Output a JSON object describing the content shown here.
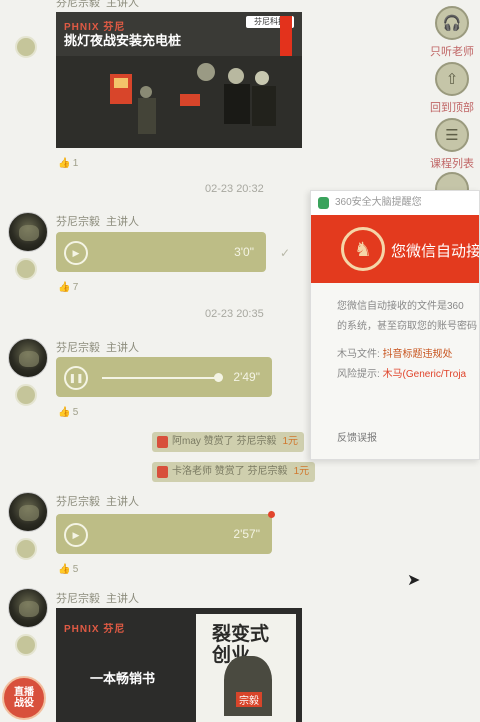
{
  "chat": {
    "sender_name": "芬尼宗毅",
    "sender_role": "主讲人",
    "messages": [
      {
        "type": "image",
        "brand": "PHNIX 芬尼",
        "headline": "挑灯夜战安装充电桩",
        "logo": "芬尼科技",
        "likes": "1"
      },
      {
        "timestamp": "02-23 20:32"
      },
      {
        "type": "audio",
        "duration": "3'0\"",
        "likes": "7",
        "read": true
      },
      {
        "timestamp": "02-23 20:35"
      },
      {
        "type": "audio",
        "duration": "2'49\"",
        "likes": "5",
        "playing": true,
        "progress_fraction": 0.97
      },
      {
        "type": "audio",
        "duration": "2'57\"",
        "likes": "5",
        "unread": true
      },
      {
        "type": "image",
        "brand": "PHNIX 芬尼",
        "headline": "一本畅销书",
        "book_title": "裂变式创业",
        "book_author": "宗毅"
      }
    ],
    "gifts": [
      {
        "text": "阿may 赞赏了 芬尼宗毅",
        "amount": "1元"
      },
      {
        "text": "卡洛老师 赞赏了 芬尼宗毅",
        "amount": "1元"
      }
    ],
    "corner_badge": "直播战役"
  },
  "sidebar": {
    "items": [
      {
        "label": "只听老师",
        "icon": "headphone-icon"
      },
      {
        "label": "回到顶部",
        "icon": "top-icon"
      },
      {
        "label": "课程列表",
        "icon": "list-icon"
      }
    ]
  },
  "popup": {
    "app": "360安全大脑提醒您",
    "title": "您微信自动接收",
    "desc_1": "您微信自动接收的文件是360",
    "desc_2": "的系统，甚至窃取您的账号密码",
    "file_label": "木马文件:",
    "file_name": "抖音标题违规处",
    "risk_label": "风险提示:",
    "risk_value": "木马(Generic/Troja",
    "feedback": "反馈误报"
  },
  "colors": {
    "bubble": "#bdbd86",
    "popup_red": "#e33a1e",
    "accent_red": "#e2452c",
    "sidebar_label": "#c06666"
  }
}
